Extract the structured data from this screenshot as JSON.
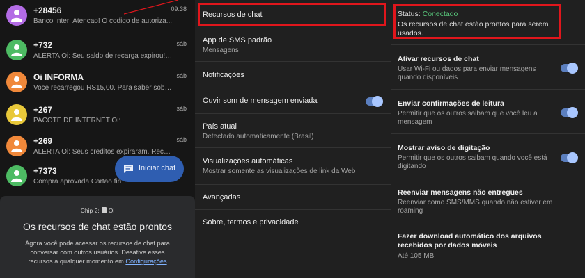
{
  "colors": {
    "accent": "#5b7fbf",
    "highlight": "#e0161c",
    "connected": "#58c77b"
  },
  "conversations": [
    {
      "name": "+28456",
      "preview": "Banco Inter: Atencao! O codigo de autoriza...",
      "time": "09:38",
      "avatar_color": "#b36ce5"
    },
    {
      "name": "+732",
      "preview": "ALERTA Oi: Seu saldo de recarga expirou! R...",
      "time": "sáb",
      "avatar_color": "#4dbb63"
    },
    {
      "name": "Oi INFORMA",
      "preview": "Voce recarregou RS15,00. Para saber sobre ...",
      "time": "sáb",
      "avatar_color": "#f0883a"
    },
    {
      "name": "+267",
      "preview": "PACOTE DE INTERNET Oi:",
      "time": "sáb",
      "avatar_color": "#e8c83a"
    },
    {
      "name": "+269",
      "preview": "ALERTA Oi: Seus creditos expiraram. Recarr...",
      "time": "sáb",
      "avatar_color": "#f0883a"
    },
    {
      "name": "+7373",
      "preview": "Compra aprovada Cartao fin",
      "time": "",
      "avatar_color": "#4dbb63"
    }
  ],
  "fab": {
    "label": "Iniciar chat"
  },
  "chip_card": {
    "chip_label_prefix": "Chip 2:",
    "chip_label_suffix": "Oi",
    "title": "Os recursos de chat estão prontos",
    "body": "Agora você pode acessar os recursos de chat para conversar com outros usuários. Desative esses recursos a qualquer momento em",
    "link": "Configurações"
  },
  "settings": [
    {
      "title": "Recursos de chat",
      "sub": ""
    },
    {
      "title": "App de SMS padrão",
      "sub": "Mensagens"
    },
    {
      "title": "Notificações",
      "sub": ""
    },
    {
      "title": "Ouvir som de mensagem enviada",
      "sub": "",
      "toggle": true
    },
    {
      "title": "País atual",
      "sub": "Detectado automaticamente (Brasil)"
    },
    {
      "title": "Visualizações automáticas",
      "sub": "Mostrar somente as visualizações de link da Web"
    },
    {
      "title": "Avançadas",
      "sub": ""
    },
    {
      "title": "Sobre, termos e privacidade",
      "sub": ""
    }
  ],
  "chat": {
    "status_label": "Status:",
    "status_value": "Conectado",
    "status_desc": "Os recursos de chat estão prontos para serem usados.",
    "options": [
      {
        "title": "Ativar recursos de chat",
        "desc": "Usar Wi-Fi ou dados para enviar mensagens quando disponíveis",
        "toggle": true
      },
      {
        "title": "Enviar confirmações de leitura",
        "desc": "Permitir que os outros saibam que você leu a mensagem",
        "toggle": true
      },
      {
        "title": "Mostrar aviso de digitação",
        "desc": "Permitir que os outros saibam quando você está digitando",
        "toggle": true
      },
      {
        "title": "Reenviar mensagens não entregues",
        "desc": "Reenviar como SMS/MMS quando não estiver em roaming",
        "toggle": false
      },
      {
        "title": "Fazer download automático dos arquivos recebidos por dados móveis",
        "desc": "Até 105 MB",
        "toggle": false
      }
    ]
  }
}
